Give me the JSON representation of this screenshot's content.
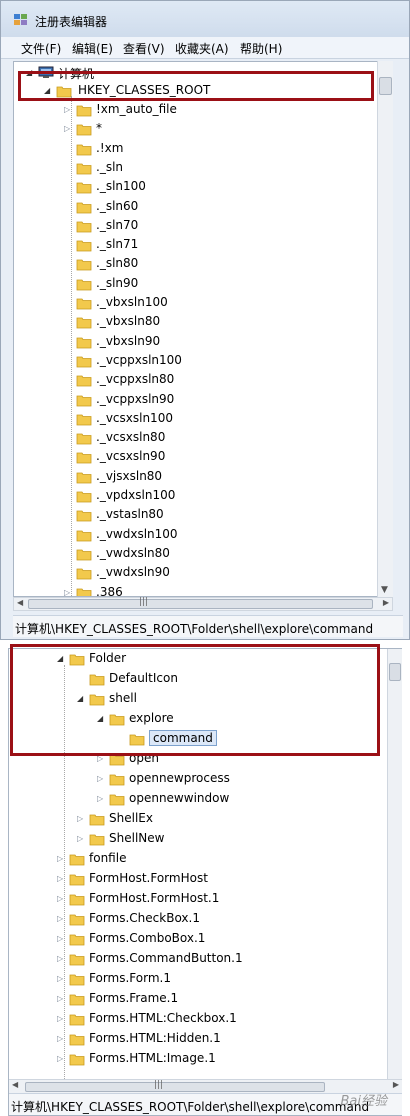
{
  "window_top": {
    "title": "注册表编辑器",
    "menu": [
      "文件(F)",
      "编辑(E)",
      "查看(V)",
      "收藏夹(A)",
      "帮助(H)"
    ],
    "root_label": "计算机",
    "hive_label": "HKEY_CLASSES_ROOT",
    "items": [
      {
        "label": "!xm_auto_file",
        "expandable": true
      },
      {
        "label": "*",
        "expandable": true
      },
      {
        "label": ".!xm",
        "expandable": false
      },
      {
        "label": "._sln",
        "expandable": false
      },
      {
        "label": "._sln100",
        "expandable": false
      },
      {
        "label": "._sln60",
        "expandable": false
      },
      {
        "label": "._sln70",
        "expandable": false
      },
      {
        "label": "._sln71",
        "expandable": false
      },
      {
        "label": "._sln80",
        "expandable": false
      },
      {
        "label": "._sln90",
        "expandable": false
      },
      {
        "label": "._vbxsln100",
        "expandable": false
      },
      {
        "label": "._vbxsln80",
        "expandable": false
      },
      {
        "label": "._vbxsln90",
        "expandable": false
      },
      {
        "label": "._vcppxsln100",
        "expandable": false
      },
      {
        "label": "._vcppxsln80",
        "expandable": false
      },
      {
        "label": "._vcppxsln90",
        "expandable": false
      },
      {
        "label": "._vcsxsln100",
        "expandable": false
      },
      {
        "label": "._vcsxsln80",
        "expandable": false
      },
      {
        "label": "._vcsxsln90",
        "expandable": false
      },
      {
        "label": "._vjsxsln80",
        "expandable": false
      },
      {
        "label": "._vpdxsln100",
        "expandable": false
      },
      {
        "label": "._vstasln80",
        "expandable": false
      },
      {
        "label": "._vwdxsln100",
        "expandable": false
      },
      {
        "label": "._vwdxsln80",
        "expandable": false
      },
      {
        "label": "._vwdxsln90",
        "expandable": false
      },
      {
        "label": ".386",
        "expandable": true
      }
    ],
    "status": "计算机\\HKEY_CLASSES_ROOT\\Folder\\shell\\explore\\command"
  },
  "window_bottom": {
    "items": [
      {
        "label": "Folder",
        "level": 0,
        "state": "open"
      },
      {
        "label": "DefaultIcon",
        "level": 1,
        "state": "none"
      },
      {
        "label": "shell",
        "level": 1,
        "state": "open"
      },
      {
        "label": "explore",
        "level": 2,
        "state": "open"
      },
      {
        "label": "command",
        "level": 3,
        "state": "none",
        "selected": true
      },
      {
        "label": "open",
        "level": 2,
        "state": "closed"
      },
      {
        "label": "opennewprocess",
        "level": 2,
        "state": "closed"
      },
      {
        "label": "opennewwindow",
        "level": 2,
        "state": "closed"
      },
      {
        "label": "ShellEx",
        "level": 1,
        "state": "closed"
      },
      {
        "label": "ShellNew",
        "level": 1,
        "state": "closed"
      },
      {
        "label": "fonfile",
        "level": 0,
        "state": "closed"
      },
      {
        "label": "FormHost.FormHost",
        "level": 0,
        "state": "closed"
      },
      {
        "label": "FormHost.FormHost.1",
        "level": 0,
        "state": "closed"
      },
      {
        "label": "Forms.CheckBox.1",
        "level": 0,
        "state": "closed"
      },
      {
        "label": "Forms.ComboBox.1",
        "level": 0,
        "state": "closed"
      },
      {
        "label": "Forms.CommandButton.1",
        "level": 0,
        "state": "closed"
      },
      {
        "label": "Forms.Form.1",
        "level": 0,
        "state": "closed"
      },
      {
        "label": "Forms.Frame.1",
        "level": 0,
        "state": "closed"
      },
      {
        "label": "Forms.HTML:Checkbox.1",
        "level": 0,
        "state": "closed"
      },
      {
        "label": "Forms.HTML:Hidden.1",
        "level": 0,
        "state": "closed"
      },
      {
        "label": "Forms.HTML:Image.1",
        "level": 0,
        "state": "closed"
      }
    ],
    "status": "计算机\\HKEY_CLASSES_ROOT\\Folder\\shell\\explore\\command",
    "watermark": "Bai经验"
  },
  "colors": {
    "annotation_red": "#9b1016",
    "folder_yellow": "#f2c94c",
    "selection": "#dce8f8"
  },
  "icons": [
    "regedit-icon",
    "computer-icon",
    "folder-icon",
    "expand-arrow-icon",
    "collapse-arrow-icon"
  ]
}
